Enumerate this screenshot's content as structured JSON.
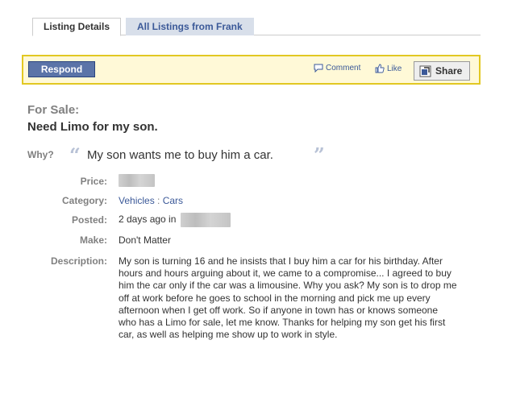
{
  "tabs": {
    "active": "Listing Details",
    "inactive": "All Listings from Frank"
  },
  "actions": {
    "respond": "Respond",
    "comment": "Comment",
    "like": "Like",
    "share": "Share"
  },
  "listing": {
    "heading": "For Sale:",
    "title": "Need Limo for my son.",
    "why_label": "Why?",
    "why_text": "My son wants me to buy him a car.",
    "fields": {
      "price_label": "Price:",
      "category_label": "Category:",
      "category_main": "Vehicles",
      "category_sep": " : ",
      "category_sub": "Cars",
      "posted_label": "Posted:",
      "posted_value": "2 days ago in",
      "make_label": "Make:",
      "make_value": "Don't Matter",
      "description_label": "Description:",
      "description": "My son is turning 16 and he insists that I buy him a car for his birthday. After hours and hours arguing about it, we came to a compromise... I agreed to buy him the car only if the car was a limousine. Why you ask? My son is to drop me off at work before he goes to school in the morning and pick me up every afternoon when I get off work. So if anyone in town has or knows someone who has a Limo for sale, let me know. Thanks for helping my son get his first car, as well as helping me show up to work in style."
    }
  },
  "colors": {
    "link": "#3b5998",
    "label": "#808080",
    "highlight_bg": "#fff9d7",
    "highlight_border": "#e2c822",
    "button": "#5b74a8"
  }
}
